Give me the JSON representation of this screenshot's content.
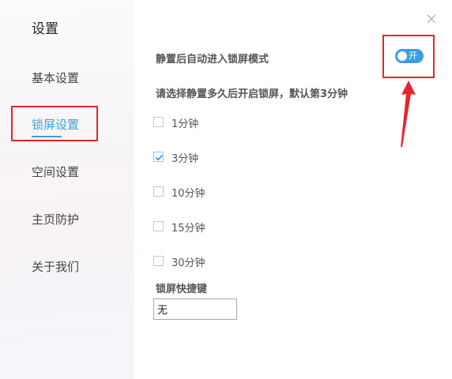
{
  "sidebar": {
    "title": "设置",
    "items": [
      {
        "label": "基本设置",
        "active": false
      },
      {
        "label": "锁屏设置",
        "active": true
      },
      {
        "label": "空间设置",
        "active": false
      },
      {
        "label": "主页防护",
        "active": false
      },
      {
        "label": "关于我们",
        "active": false
      }
    ]
  },
  "main": {
    "auto_lock_label": "静置后自动进入锁屏模式",
    "toggle": {
      "label": "开",
      "on": true
    },
    "duration_prompt": "请选择静置多久后开启锁屏，默认第3分钟",
    "options": [
      {
        "label": "1分钟",
        "checked": false
      },
      {
        "label": "3分钟",
        "checked": true
      },
      {
        "label": "10分钟",
        "checked": false
      },
      {
        "label": "15分钟",
        "checked": false
      },
      {
        "label": "30分钟",
        "checked": false
      }
    ],
    "shortcut_label": "锁屏快捷键",
    "shortcut_value": "无"
  },
  "colors": {
    "accent": "#3fa0de",
    "toggle_on": "#3a9ee3",
    "highlight": "#e8242c"
  }
}
